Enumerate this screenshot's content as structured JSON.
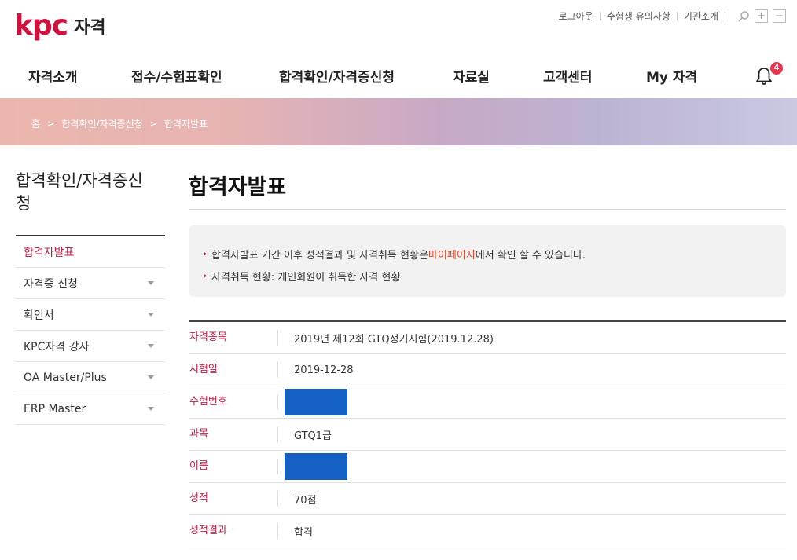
{
  "header": {
    "logo_mark": "kpc",
    "logo_text": "자격",
    "util_links": [
      "로그아웃",
      "수험생 유의사항",
      "기관소개"
    ],
    "notification_count": "4"
  },
  "gnb": [
    "자격소개",
    "접수/수험표확인",
    "합격확인/자격증신청",
    "자료실",
    "고객센터",
    "My 자격"
  ],
  "breadcrumb": [
    "홈",
    "합격확인/자격증신청",
    "합격자발표"
  ],
  "lnb": {
    "title": "합격확인/자격증신청",
    "items": [
      {
        "label": "합격자발표",
        "active": true
      },
      {
        "label": "자격증 신청"
      },
      {
        "label": "확인서"
      },
      {
        "label": "KPC자격 강사"
      },
      {
        "label": "OA Master/Plus"
      },
      {
        "label": "ERP Master"
      }
    ]
  },
  "page": {
    "title": "합격자발표",
    "notice": {
      "line1_pre": "합격자발표 기간 이후 성적결과 및 자격취득 현황은 ",
      "line1_link": "마이페이지",
      "line1_post": "에서 확인 할 수 있습니다.",
      "line2": "자격취득 현황: 개인회원이 취득한 자격 현황"
    },
    "result": [
      {
        "label": "자격종목",
        "value": "2019년 제12회 GTQ정기시험(2019.12.28)"
      },
      {
        "label": "시험일",
        "value": "2019-12-28"
      },
      {
        "label": "수험번호",
        "value": ""
      },
      {
        "label": "과목",
        "value": "GTQ1급"
      },
      {
        "label": "이름",
        "value": ""
      },
      {
        "label": "성적",
        "value": "70점"
      },
      {
        "label": "성적결과",
        "value": "합격"
      }
    ]
  },
  "colors": {
    "brand": "#d0113d",
    "mask": "#1560c4",
    "badge": "#e8344e"
  }
}
